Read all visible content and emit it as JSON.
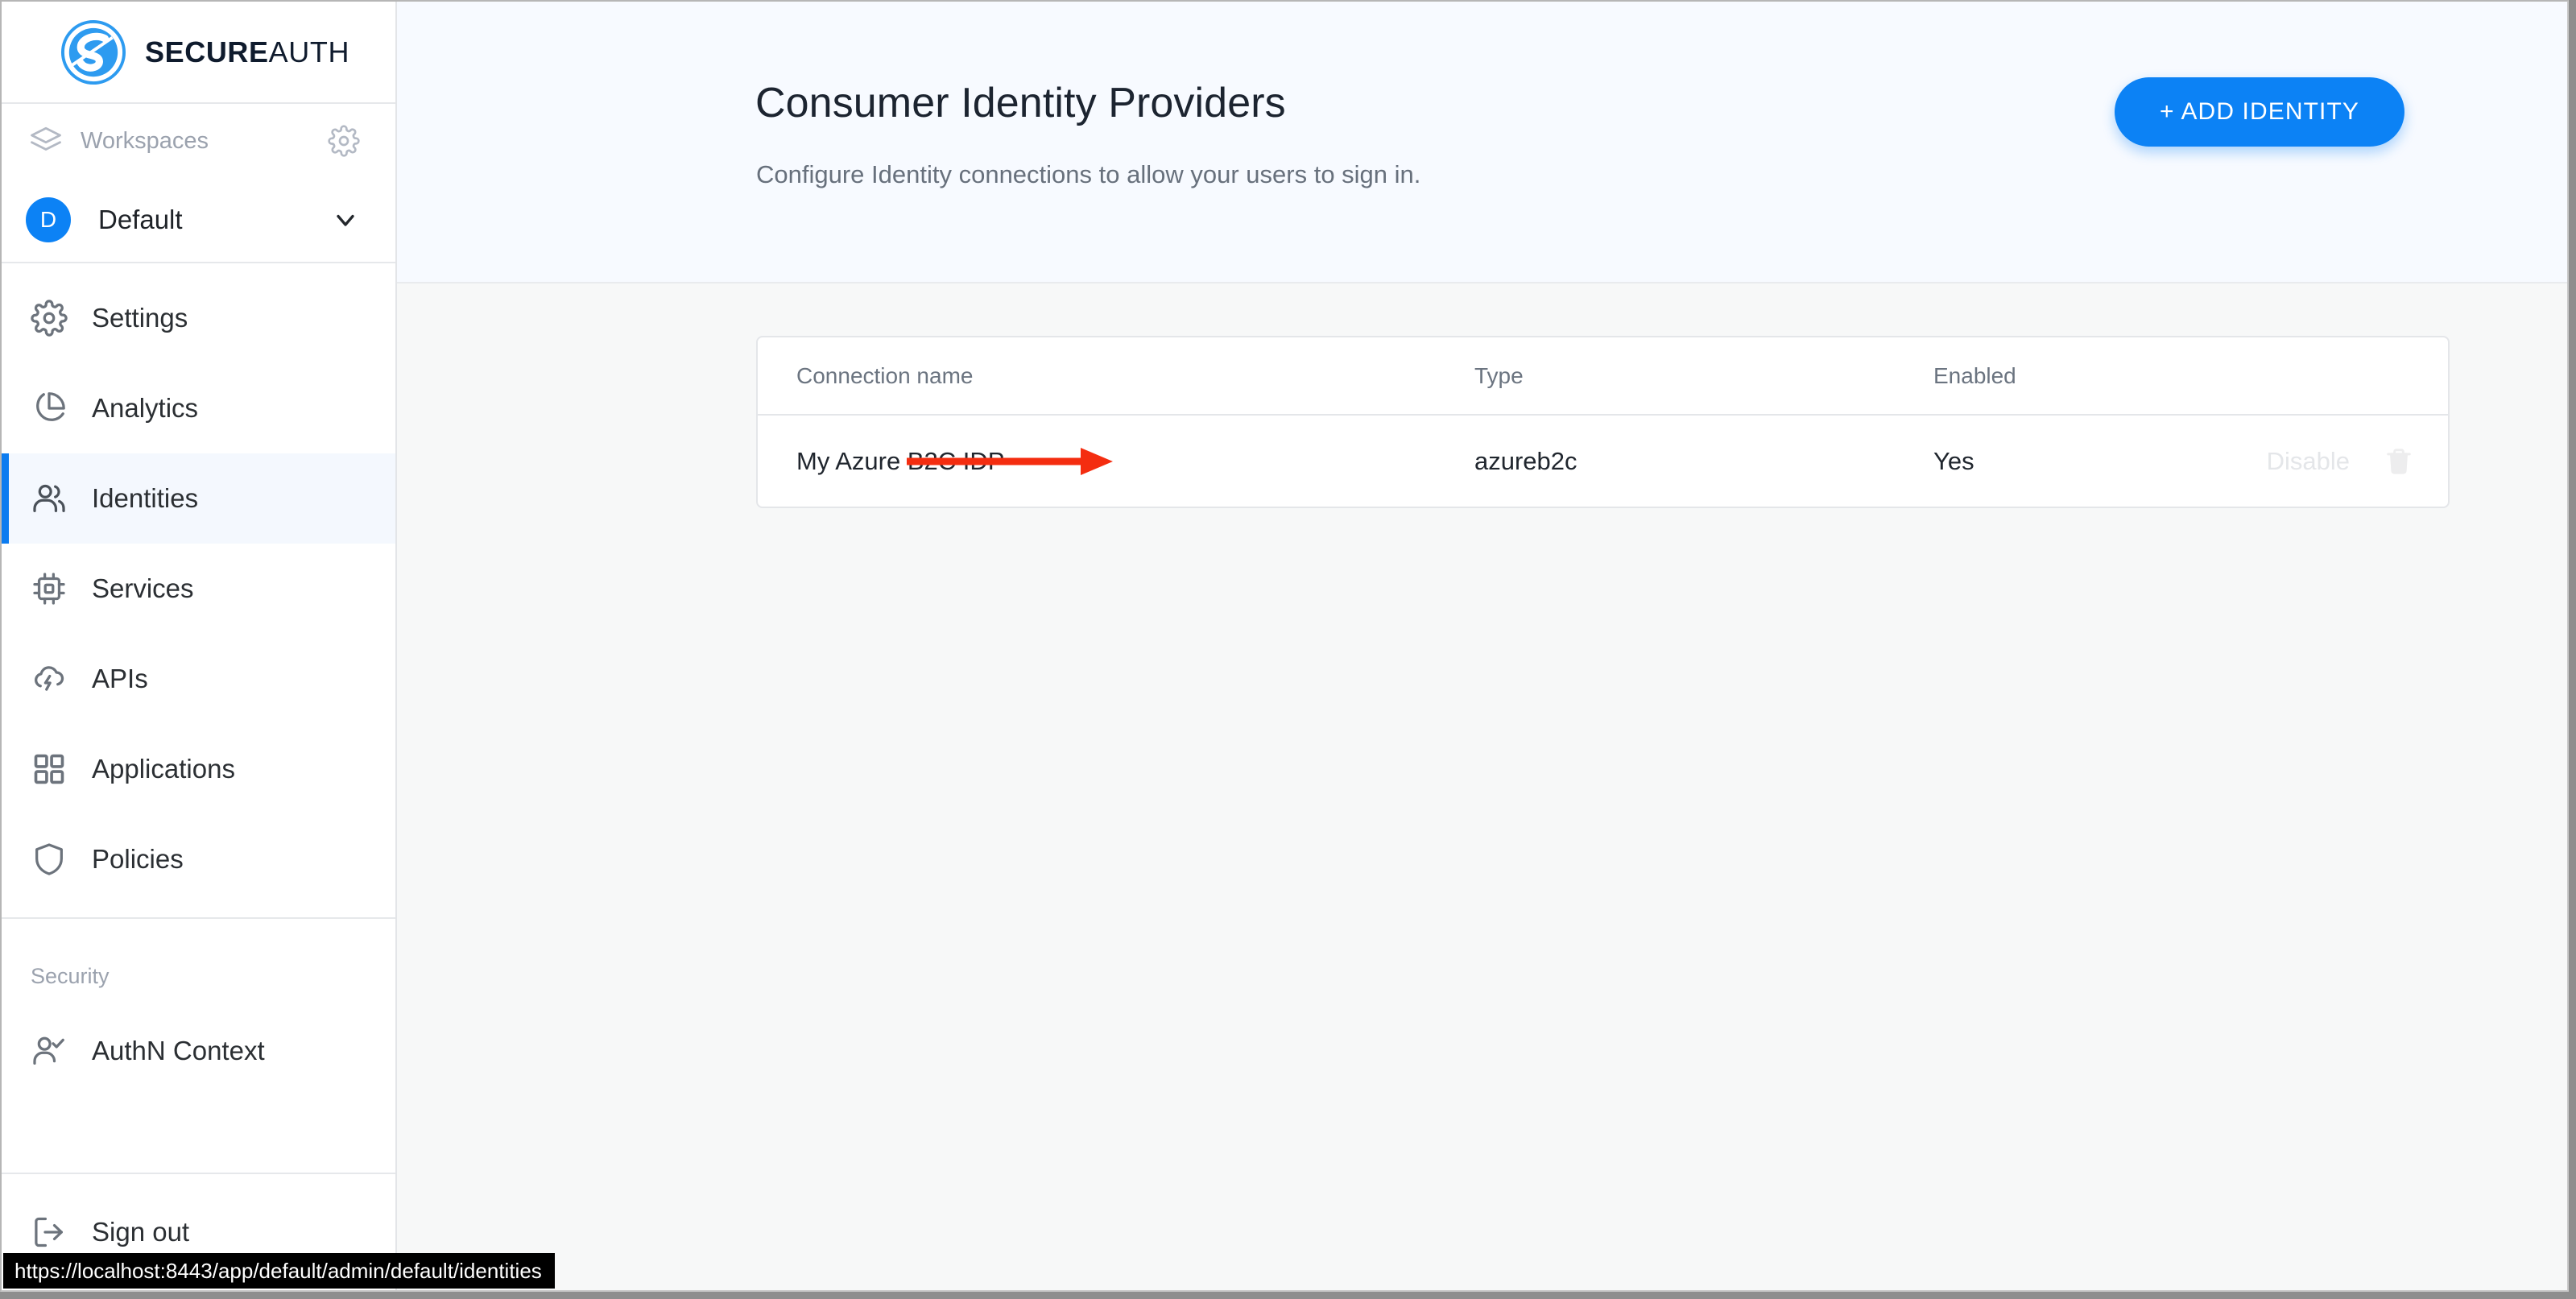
{
  "brand": {
    "logo_icon": "secureauth-logo-icon",
    "name_bold": "SECURE",
    "name_light": "AUTH"
  },
  "sidebar": {
    "workspaces": {
      "icon": "layers-icon",
      "label": "Workspaces",
      "settings_icon": "gear-icon"
    },
    "workspace_selector": {
      "avatar_initial": "D",
      "label": "Default",
      "chevron_icon": "chevron-down-icon"
    },
    "nav_items": [
      {
        "icon": "gear-icon",
        "label": "Settings",
        "active": false
      },
      {
        "icon": "pie-chart-icon",
        "label": "Analytics",
        "active": false
      },
      {
        "icon": "users-icon",
        "label": "Identities",
        "active": true
      },
      {
        "icon": "chip-icon",
        "label": "Services",
        "active": false
      },
      {
        "icon": "cloud-bolt-icon",
        "label": "APIs",
        "active": false
      },
      {
        "icon": "grid-icon",
        "label": "Applications",
        "active": false
      },
      {
        "icon": "shield-icon",
        "label": "Policies",
        "active": false
      }
    ],
    "security_section": {
      "title": "Security",
      "items": [
        {
          "icon": "user-check-icon",
          "label": "AuthN Context"
        }
      ]
    },
    "sign_out": {
      "icon": "logout-icon",
      "label": "Sign out"
    }
  },
  "header": {
    "title": "Consumer Identity Providers",
    "subtitle": "Configure Identity connections to allow your users to sign in.",
    "add_button_label": "+ ADD IDENTITY",
    "accent_color": "#0c82f5"
  },
  "table": {
    "columns": [
      "Connection name",
      "Type",
      "Enabled"
    ],
    "rows": [
      {
        "connection_name": "My Azure B2C IDP",
        "type": "azureb2c",
        "enabled": "Yes",
        "action_label": "Disable",
        "delete_icon": "trash-icon"
      }
    ]
  },
  "annotation": {
    "arrow_icon": "red-arrow-right-icon",
    "color": "#f42d10"
  },
  "status_bar": {
    "url": "https://localhost:8443/app/default/admin/default/identities"
  }
}
